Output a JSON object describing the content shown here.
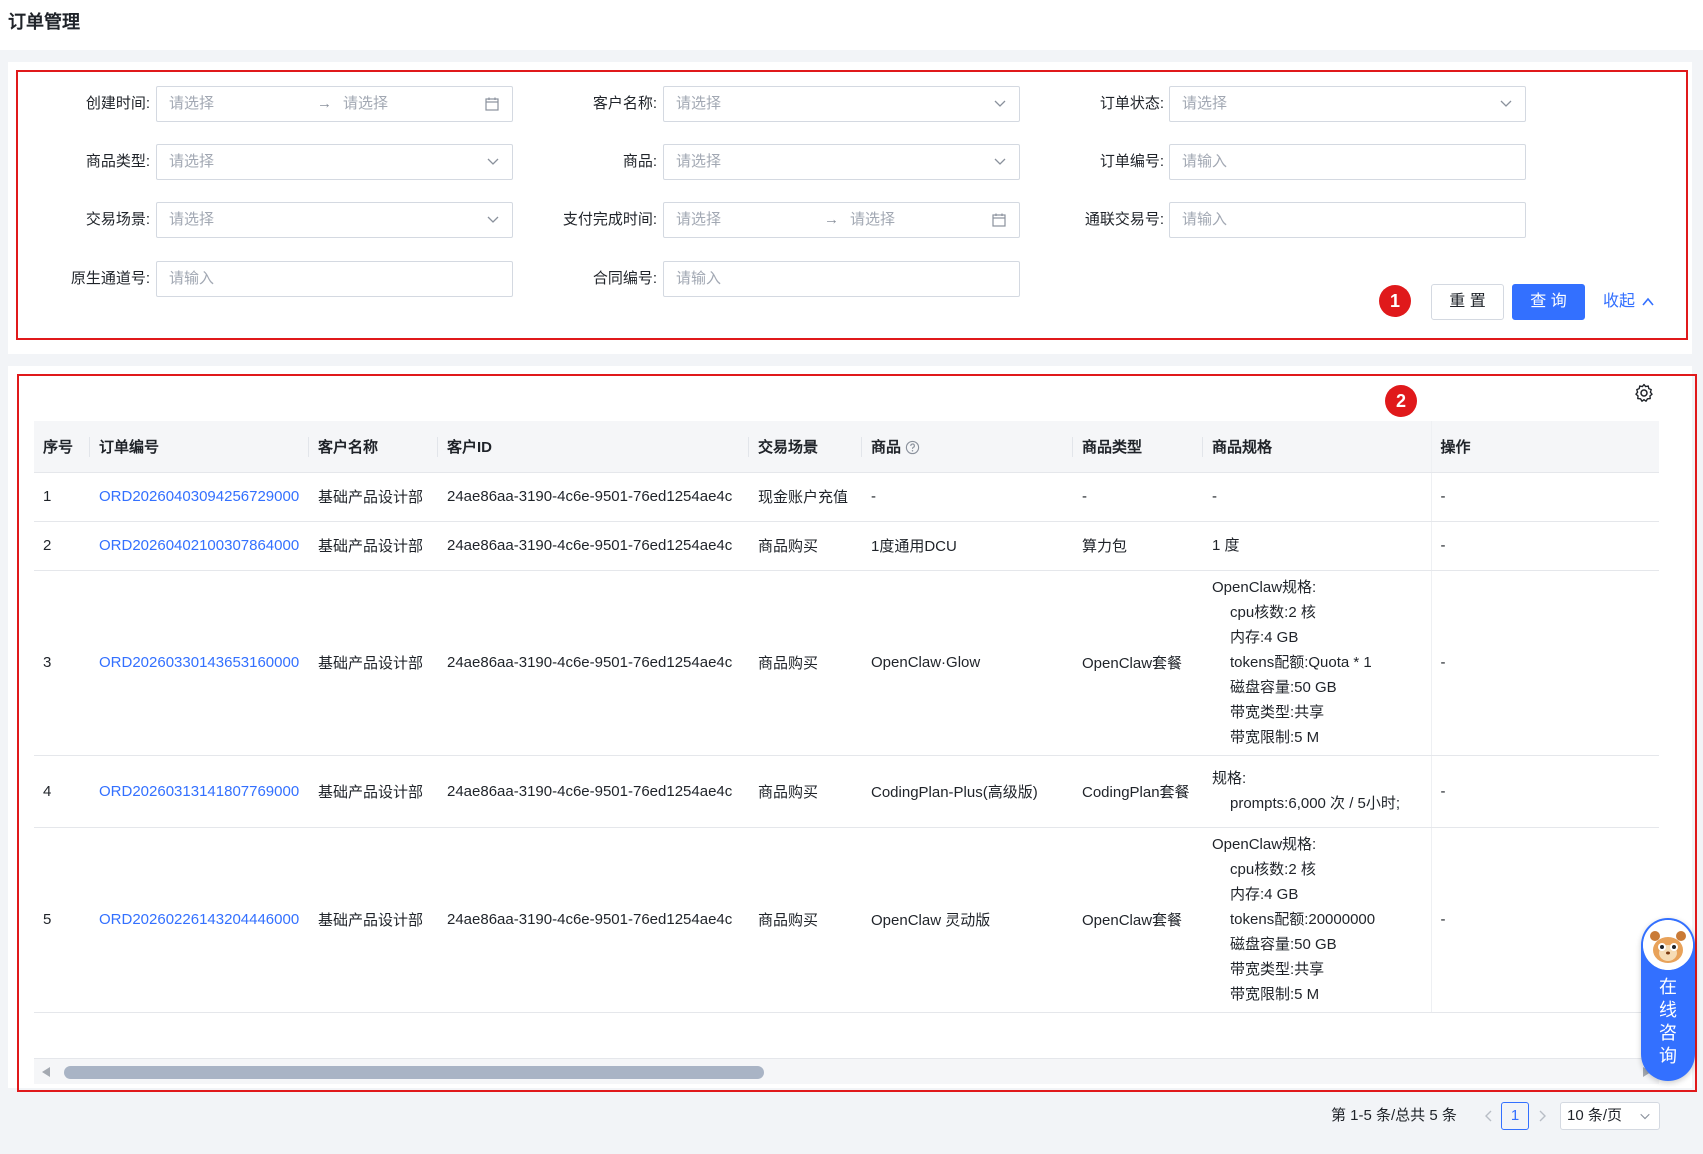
{
  "header": {
    "title": "订单管理"
  },
  "filters": {
    "created_time": {
      "label": "创建时间:",
      "start_placeholder": "请选择",
      "end_placeholder": "请选择",
      "arrow": "→"
    },
    "customer_name": {
      "label": "客户名称:",
      "placeholder": "请选择"
    },
    "order_status": {
      "label": "订单状态:",
      "placeholder": "请选择"
    },
    "product_type": {
      "label": "商品类型:",
      "placeholder": "请选择"
    },
    "product": {
      "label": "商品:",
      "placeholder": "请选择"
    },
    "order_no": {
      "label": "订单编号:",
      "placeholder": "请输入"
    },
    "trade_scene": {
      "label": "交易场景:",
      "placeholder": "请选择"
    },
    "pay_time": {
      "label": "支付完成时间:",
      "start_placeholder": "请选择",
      "end_placeholder": "请选择",
      "arrow": "→"
    },
    "union_trade_no": {
      "label": "通联交易号:",
      "placeholder": "请输入"
    },
    "channel_no": {
      "label": "原生通道号:",
      "placeholder": "请输入"
    },
    "contract_no": {
      "label": "合同编号:",
      "placeholder": "请输入"
    }
  },
  "actions": {
    "reset": "重 置",
    "query": "查 询",
    "collapse": "收起"
  },
  "badges": {
    "filter": "1",
    "table": "2"
  },
  "table": {
    "columns": [
      "序号",
      "订单编号",
      "客户名称",
      "客户ID",
      "交易场景",
      "商品",
      "商品类型",
      "商品规格",
      "操作"
    ],
    "rows": [
      {
        "index": "1",
        "order_no": "ORD20260403094256729000",
        "customer": "基础产品设计部",
        "customer_id": "24ae86aa-3190-4c6e-9501-76ed1254ae4c",
        "scene": "现金账户充值",
        "product": "-",
        "product_type": "-",
        "spec_title": "-",
        "spec_lines": [],
        "op": "-"
      },
      {
        "index": "2",
        "order_no": "ORD20260402100307864000",
        "customer": "基础产品设计部",
        "customer_id": "24ae86aa-3190-4c6e-9501-76ed1254ae4c",
        "scene": "商品购买",
        "product": "1度通用DCU",
        "product_type": "算力包",
        "spec_title": "1 度",
        "spec_lines": [],
        "op": "-"
      },
      {
        "index": "3",
        "order_no": "ORD20260330143653160000",
        "customer": "基础产品设计部",
        "customer_id": "24ae86aa-3190-4c6e-9501-76ed1254ae4c",
        "scene": "商品购买",
        "product": "OpenClaw·Glow",
        "product_type": "OpenClaw套餐",
        "spec_title": "OpenClaw规格:",
        "spec_lines": [
          "cpu核数:2 核",
          "内存:4 GB",
          "tokens配额:Quota * 1",
          "磁盘容量:50 GB",
          "带宽类型:共享",
          "带宽限制:5 M"
        ],
        "op": "-"
      },
      {
        "index": "4",
        "order_no": "ORD20260313141807769000",
        "customer": "基础产品设计部",
        "customer_id": "24ae86aa-3190-4c6e-9501-76ed1254ae4c",
        "scene": "商品购买",
        "product": "CodingPlan-Plus(高级版)",
        "product_type": "CodingPlan套餐",
        "spec_title": "规格:",
        "spec_lines": [
          "prompts:6,000 次 / 5小时;"
        ],
        "op": "-"
      },
      {
        "index": "5",
        "order_no": "ORD20260226143204446000",
        "customer": "基础产品设计部",
        "customer_id": "24ae86aa-3190-4c6e-9501-76ed1254ae4c",
        "scene": "商品购买",
        "product": "OpenClaw 灵动版",
        "product_type": "OpenClaw套餐",
        "spec_title": "OpenClaw规格:",
        "spec_lines": [
          "cpu核数:2 核",
          "内存:4 GB",
          "tokens配额:20000000",
          "磁盘容量:50 GB",
          "带宽类型:共享",
          "带宽限制:5 M"
        ],
        "op": "-"
      }
    ]
  },
  "pagination": {
    "total_text": "第 1-5 条/总共 5 条",
    "current_page": "1",
    "page_size": "10 条/页"
  },
  "consult": {
    "label": "在线咨询"
  },
  "colors": {
    "accent": "#3370ff",
    "annotation": "#e0191b"
  }
}
